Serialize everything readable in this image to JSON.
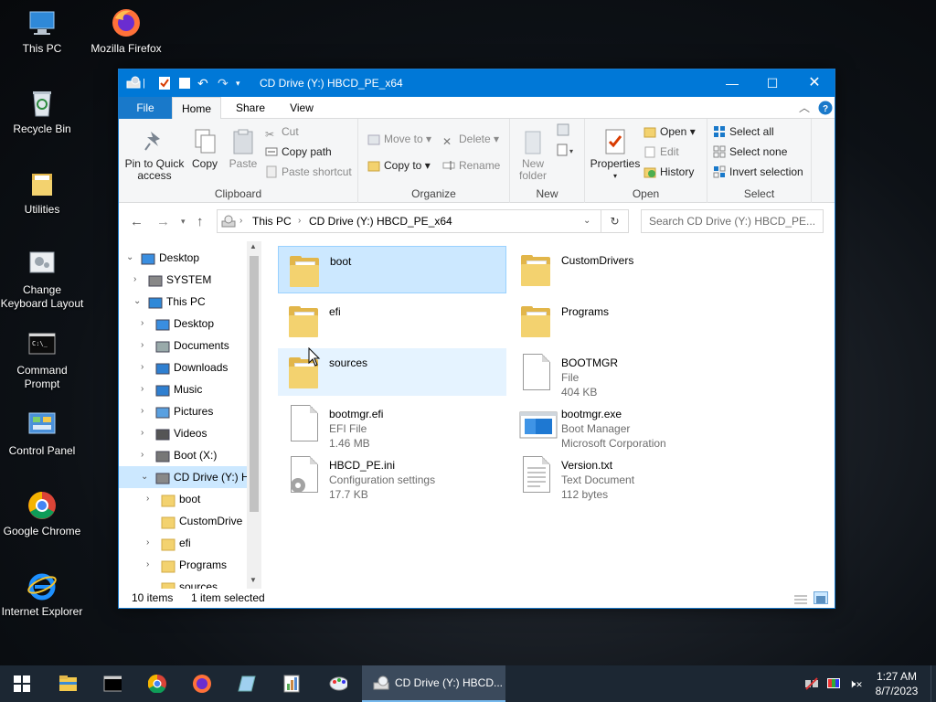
{
  "desktop": {
    "icons": [
      {
        "label": "This PC"
      },
      {
        "label": "Mozilla Firefox"
      },
      {
        "label": "Recycle Bin"
      },
      {
        "label": "Utilities"
      },
      {
        "label": "Change Keyboard Layout"
      },
      {
        "label": "Command Prompt"
      },
      {
        "label": "Control Panel"
      },
      {
        "label": "Google Chrome"
      },
      {
        "label": "Internet Explorer"
      }
    ]
  },
  "window": {
    "title": "CD Drive (Y:) HBCD_PE_x64",
    "tabs": {
      "file": "File",
      "home": "Home",
      "share": "Share",
      "view": "View"
    },
    "ribbon": {
      "clipboard": {
        "label": "Clipboard",
        "pin": "Pin to Quick access",
        "copy": "Copy",
        "paste": "Paste",
        "cut": "Cut",
        "copy_path": "Copy path",
        "paste_shortcut": "Paste shortcut"
      },
      "organize": {
        "label": "Organize",
        "move_to": "Move to",
        "copy_to": "Copy to",
        "delete": "Delete",
        "rename": "Rename"
      },
      "new": {
        "label": "New",
        "new_folder": "New folder"
      },
      "open": {
        "label": "Open",
        "properties": "Properties",
        "open": "Open",
        "edit": "Edit",
        "history": "History"
      },
      "select": {
        "label": "Select",
        "select_all": "Select all",
        "select_none": "Select none",
        "invert": "Invert selection"
      }
    },
    "address": {
      "crumbs": [
        "This PC",
        "CD Drive (Y:) HBCD_PE_x64"
      ],
      "search_placeholder": "Search CD Drive (Y:) HBCD_PE..."
    },
    "tree": [
      {
        "label": "Desktop",
        "level": 0,
        "expanded": true
      },
      {
        "label": "SYSTEM",
        "level": 1
      },
      {
        "label": "This PC",
        "level": 1,
        "expanded": true
      },
      {
        "label": "Desktop",
        "level": 2
      },
      {
        "label": "Documents",
        "level": 2
      },
      {
        "label": "Downloads",
        "level": 2
      },
      {
        "label": "Music",
        "level": 2
      },
      {
        "label": "Pictures",
        "level": 2
      },
      {
        "label": "Videos",
        "level": 2
      },
      {
        "label": "Boot (X:)",
        "level": 2
      },
      {
        "label": "CD Drive (Y:) H",
        "level": 2,
        "expanded": true,
        "selected": true
      },
      {
        "label": "boot",
        "level": 3
      },
      {
        "label": "CustomDrive",
        "level": 3
      },
      {
        "label": "efi",
        "level": 3
      },
      {
        "label": "Programs",
        "level": 3
      },
      {
        "label": "sources",
        "level": 3
      }
    ],
    "files": [
      {
        "name": "boot",
        "type": "folder",
        "selected": true
      },
      {
        "name": "CustomDrivers",
        "type": "folder"
      },
      {
        "name": "efi",
        "type": "folder"
      },
      {
        "name": "Programs",
        "type": "folder"
      },
      {
        "name": "sources",
        "type": "folder",
        "hover": true
      },
      {
        "name": "BOOTMGR",
        "type": "file",
        "line1": "File",
        "line2": "404 KB"
      },
      {
        "name": "bootmgr.efi",
        "type": "file",
        "line1": "EFI File",
        "line2": "1.46 MB"
      },
      {
        "name": "bootmgr.exe",
        "type": "exe",
        "line1": "Boot Manager",
        "line2": "Microsoft Corporation"
      },
      {
        "name": "HBCD_PE.ini",
        "type": "ini",
        "line1": "Configuration settings",
        "line2": "17.7 KB"
      },
      {
        "name": "Version.txt",
        "type": "txt",
        "line1": "Text Document",
        "line2": "112 bytes"
      }
    ],
    "status": {
      "count": "10 items",
      "selected": "1 item selected"
    }
  },
  "taskbar": {
    "active_window": "CD Drive (Y:) HBCD...",
    "time": "1:27 AM",
    "date": "8/7/2023"
  },
  "colors": {
    "accent": "#0078d7",
    "selection": "#cce8ff",
    "folder": "#e2b64a",
    "taskbar": "#1c2733"
  }
}
